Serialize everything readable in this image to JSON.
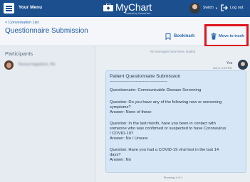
{
  "topbar": {
    "menu_label": "Your Menu",
    "logo_text": "MyChart",
    "logo_sub": "Powered by CentraCare",
    "switch_label": "Switch",
    "logout_label": "Log out"
  },
  "header": {
    "back_link": "< Conversation List",
    "title": "Questionnaire Submission",
    "bookmark_label": "Bookmark",
    "trash_label": "Move to trash"
  },
  "sidebar": {
    "participants_label": "Participants",
    "participant_name": "Teresa Hagedorn, PA"
  },
  "conversation": {
    "loaded_note": "All messages have been loaded.",
    "sender": "You",
    "date": "Oct 5, 2:23 PM",
    "message_lines": [
      "Patient Questionnaire Submission",
      "------------------------------------------",
      "Questionnaire: Communicable Disease Screening",
      "Question: Do you have any of the following new or worsening",
      "symptoms?",
      "Answer:   None of these",
      "Question: In the last month, have you been in contact with",
      "someone who was confirmed or suspected to have Coronavirus",
      "/ COVID-19?",
      "Answer:   No / Unsure",
      "Question: Have you had a COVID-19 viral test in the last 14",
      "days?",
      "Answer:   No"
    ],
    "showing": "Showing 1 of 1"
  },
  "colors": {
    "topbar": "#1b4f8e",
    "highlight": "#e0141b",
    "message_bg": "#d6e6f7",
    "link": "#2d6bb0"
  }
}
